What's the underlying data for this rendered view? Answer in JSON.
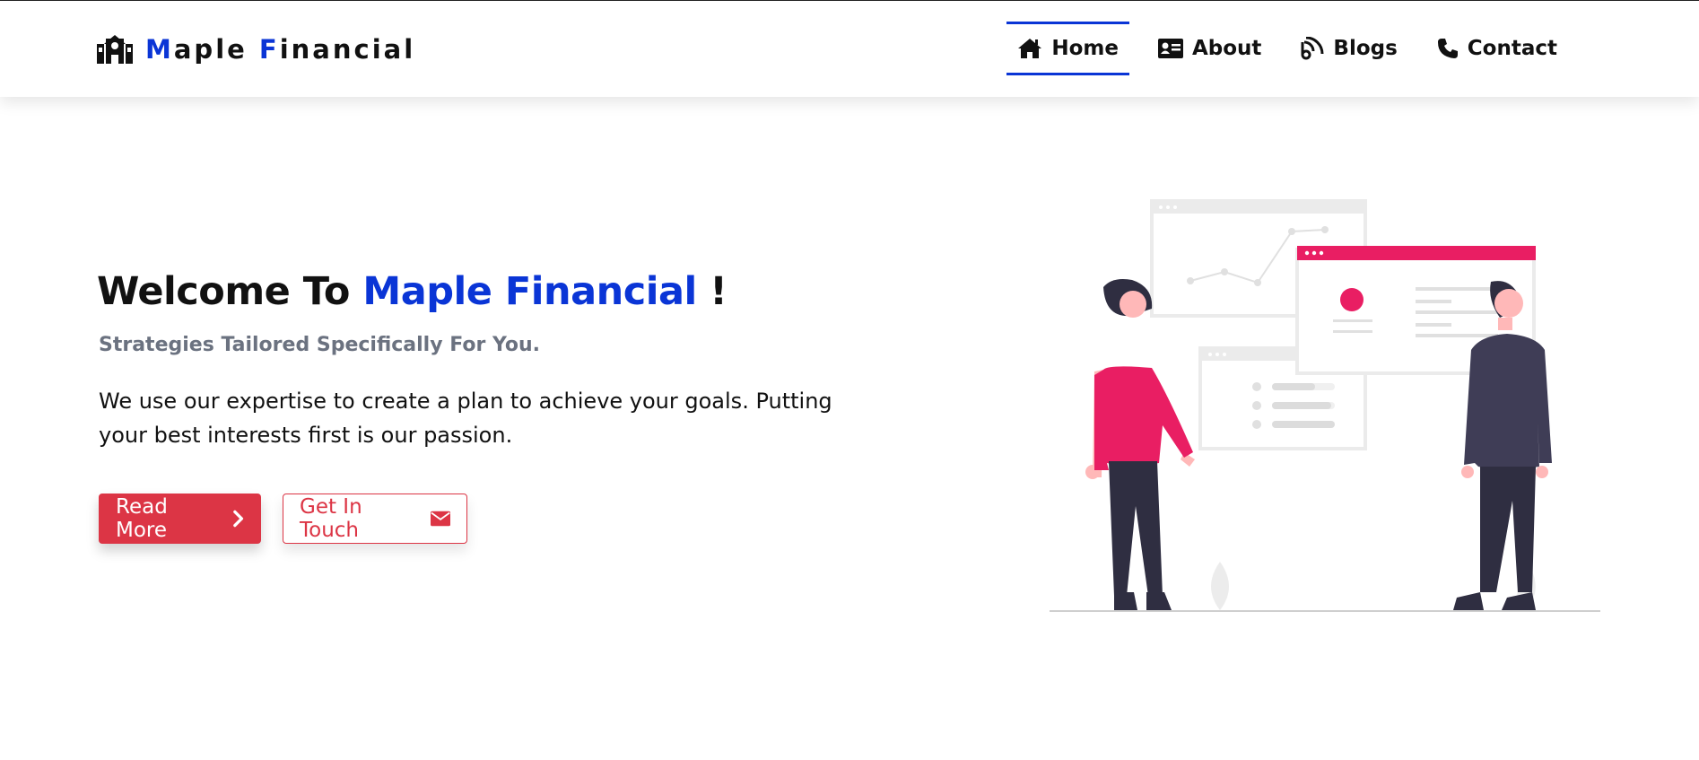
{
  "header": {
    "brand": {
      "first_letter": "M",
      "first_rest": "aple ",
      "second_letter": "F",
      "second_rest": "inancial",
      "icon": "school-building-icon"
    },
    "nav": [
      {
        "label": "Home",
        "icon": "home-icon",
        "active": true
      },
      {
        "label": "About",
        "icon": "id-card-icon",
        "active": false
      },
      {
        "label": "Blogs",
        "icon": "blog-icon",
        "active": false
      },
      {
        "label": "Contact",
        "icon": "phone-icon",
        "active": false
      }
    ]
  },
  "hero": {
    "title_prefix": "Welcome To ",
    "title_highlight": "Maple Financial",
    "title_suffix": " !",
    "subtitle": "Strategies Tailored Specifically For You.",
    "description": "We use our expertise to create a plan to achieve your goals. Putting your best interests first is our passion.",
    "buttons": {
      "read_more": {
        "label": "Read More",
        "icon": "chevron-right-icon"
      },
      "get_in_touch": {
        "label": "Get In Touch",
        "icon": "envelope-icon"
      }
    },
    "illustration": "people-presenting-dashboards-illustration"
  },
  "colors": {
    "accent": "#0a35d6",
    "button": "#dc3545",
    "subtitle": "#6b7280",
    "illustration_pink": "#e91e63",
    "illustration_dark": "#2f2e41"
  }
}
